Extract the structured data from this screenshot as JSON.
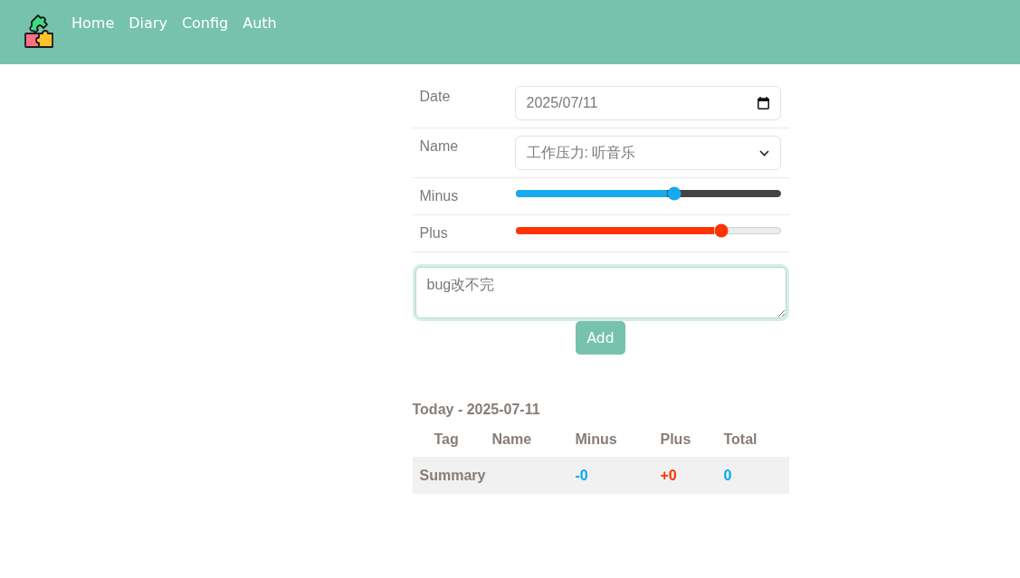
{
  "nav": {
    "links": [
      {
        "label": "Home"
      },
      {
        "label": "Diary"
      },
      {
        "label": "Config"
      },
      {
        "label": "Auth"
      }
    ]
  },
  "form": {
    "fields": [
      {
        "kind": "date",
        "label": "Date",
        "value": "2025/07/11"
      },
      {
        "kind": "select",
        "label": "Name",
        "value": "工作压力: 听音乐"
      },
      {
        "kind": "minus",
        "label": "Minus",
        "level": 0.6
      },
      {
        "kind": "plus",
        "label": "Plus",
        "level": 0.78
      }
    ],
    "note": {
      "value": "bug改不完"
    },
    "submit": {
      "label": "Add"
    }
  },
  "today": {
    "title": "Today - 2025-07-11",
    "columns": [
      "Tag",
      "Name",
      "Minus",
      "Plus",
      "Total"
    ],
    "summary": {
      "label": "Summary",
      "minus": "-0",
      "plus": "+0",
      "total": "0"
    }
  }
}
